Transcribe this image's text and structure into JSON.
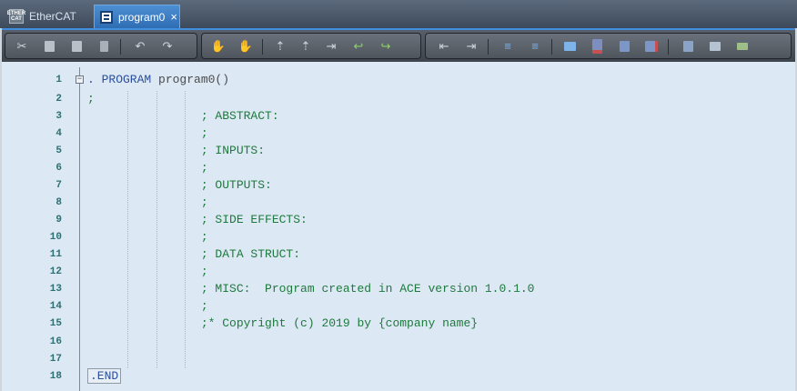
{
  "tabs": [
    {
      "label": "EtherCAT",
      "icon": "ethercat-icon",
      "icon_text_top": "ETHER",
      "icon_text_bottom": "CAT",
      "active": false
    },
    {
      "label": "program0",
      "icon": "program-icon",
      "active": true,
      "close_glyph": "×"
    }
  ],
  "toolbar": {
    "groups": [
      {
        "name": "edit",
        "buttons": [
          {
            "name": "cut-icon",
            "glyph": "✂"
          },
          {
            "name": "copy-icon",
            "glyph": ""
          },
          {
            "name": "paste-icon",
            "glyph": ""
          },
          {
            "name": "delete-icon",
            "glyph": ""
          },
          {
            "name": "undo-icon",
            "glyph": "↶"
          },
          {
            "name": "redo-icon",
            "glyph": "↷"
          }
        ]
      },
      {
        "name": "debug",
        "buttons": [
          {
            "name": "hand-icon",
            "glyph": "✋"
          },
          {
            "name": "hand-stop-icon",
            "glyph": "✋"
          },
          {
            "name": "breakpoint-icon",
            "glyph": "⇡"
          },
          {
            "name": "breakpoint-toggle-icon",
            "glyph": "⇡"
          },
          {
            "name": "step-into-icon",
            "glyph": "⇥"
          },
          {
            "name": "step-back-icon",
            "glyph": "↩"
          },
          {
            "name": "step-over-icon",
            "glyph": "↪"
          }
        ]
      },
      {
        "name": "format",
        "buttons": [
          {
            "name": "outdent-icon",
            "glyph": "⇤"
          },
          {
            "name": "indent-icon",
            "glyph": "⇥"
          },
          {
            "name": "comment-icon",
            "glyph": "≡"
          },
          {
            "name": "uncomment-icon",
            "glyph": "≡"
          },
          {
            "name": "window-icon",
            "glyph": ""
          },
          {
            "name": "bookmark-icon",
            "glyph": ""
          },
          {
            "name": "bookmark-prev-icon",
            "glyph": ""
          },
          {
            "name": "bookmark-next-icon",
            "glyph": ""
          },
          {
            "name": "task-icon",
            "glyph": ""
          },
          {
            "name": "tree-icon",
            "glyph": ""
          },
          {
            "name": "goto-icon",
            "glyph": ""
          }
        ]
      }
    ]
  },
  "editor": {
    "lines": [
      {
        "n": "1",
        "keyword": ". PROGRAM",
        "text": " program0()"
      },
      {
        "n": "2",
        "text": ";"
      },
      {
        "n": "3",
        "text": "                ; ABSTRACT:"
      },
      {
        "n": "4",
        "text": "                ;"
      },
      {
        "n": "5",
        "text": "                ; INPUTS:"
      },
      {
        "n": "6",
        "text": "                ;"
      },
      {
        "n": "7",
        "text": "                ; OUTPUTS:"
      },
      {
        "n": "8",
        "text": "                ;"
      },
      {
        "n": "9",
        "text": "                ; SIDE EFFECTS:"
      },
      {
        "n": "10",
        "text": "                ;"
      },
      {
        "n": "11",
        "text": "                ; DATA STRUCT:"
      },
      {
        "n": "12",
        "text": "                ;"
      },
      {
        "n": "13",
        "text": "                ; MISC:  Program created in ACE version 1.0.1.0"
      },
      {
        "n": "14",
        "text": "                ;"
      },
      {
        "n": "15",
        "text": "                ;* Copyright (c) 2019 by {company name}"
      },
      {
        "n": "16",
        "text": ""
      },
      {
        "n": "17",
        "text": ""
      },
      {
        "n": "18",
        "keyword": ".END",
        "text": ""
      }
    ]
  },
  "colors": {
    "accent": "#3f8ee0",
    "comment": "#1e7a3c",
    "keyword": "#2a4fa0",
    "line_number": "#2d6f73"
  }
}
